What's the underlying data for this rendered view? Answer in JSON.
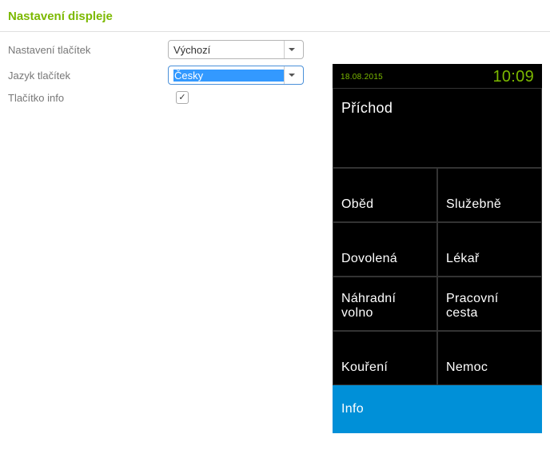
{
  "page": {
    "title": "Nastavení displeje"
  },
  "form": {
    "button_settings": {
      "label": "Nastavení tlačítek",
      "value": "Výchozí"
    },
    "button_language": {
      "label": "Jazyk tlačítek",
      "value": "Česky"
    },
    "info_button": {
      "label": "Tlačítko info",
      "checked": "✓"
    }
  },
  "preview": {
    "date": "18.08.2015",
    "time": "10:09",
    "main_tile": "Příchod",
    "tiles": [
      [
        "Oběd",
        "Služebně"
      ],
      [
        "Dovolená",
        "Lékař"
      ],
      [
        "Náhradní volno",
        "Pracovní cesta"
      ],
      [
        "Kouření",
        "Nemoc"
      ]
    ],
    "info_tile": "Info"
  }
}
